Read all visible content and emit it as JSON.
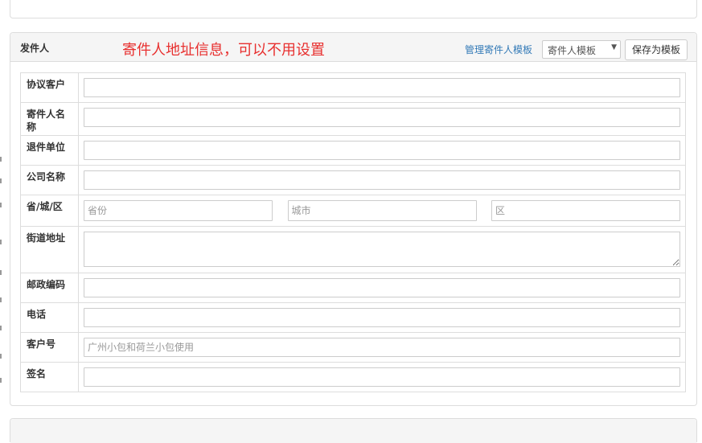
{
  "sender_panel": {
    "title": "发件人",
    "note": "寄件人地址信息，可以不用设置",
    "manage_template_link": "管理寄件人模板",
    "template_select": {
      "selected": "寄件人模板"
    },
    "save_template_button": "保存为模板"
  },
  "form": {
    "rows": [
      {
        "label": "协议客户",
        "value": ""
      },
      {
        "label": "寄件人名称",
        "value": ""
      },
      {
        "label": "退件单位",
        "value": ""
      },
      {
        "label": "公司名称",
        "value": ""
      },
      {
        "label": "省/城/区",
        "province_placeholder": "省份",
        "city_placeholder": "城市",
        "district_placeholder": "区"
      },
      {
        "label": "街道地址",
        "value": ""
      },
      {
        "label": "邮政编码",
        "value": ""
      },
      {
        "label": "电话",
        "value": ""
      },
      {
        "label": "客户号",
        "placeholder": "广州小包和荷兰小包使用"
      },
      {
        "label": "签名",
        "value": ""
      }
    ]
  }
}
